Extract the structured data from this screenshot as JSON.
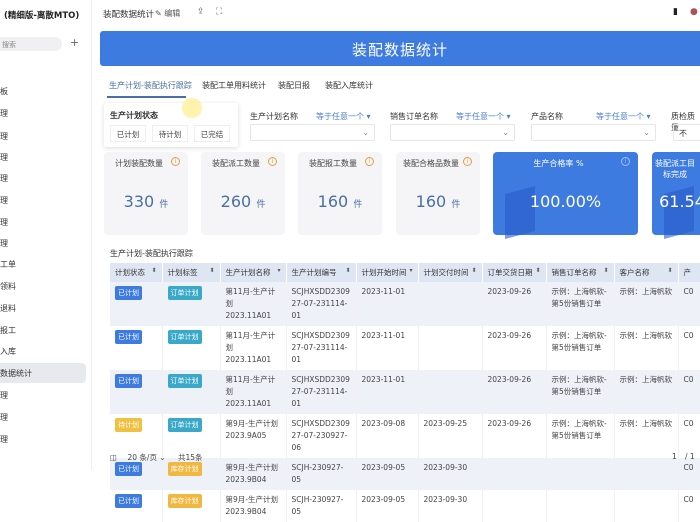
{
  "app": {
    "title": "(精细版-离散MTO)",
    "search_placeholder": "搜索",
    "add": "+"
  },
  "sidebar": {
    "items": [
      {
        "label": "板"
      },
      {
        "label": "理"
      },
      {
        "label": "理"
      },
      {
        "label": "理"
      },
      {
        "label": "理"
      },
      {
        "label": "理"
      },
      {
        "label": "理"
      },
      {
        "label": "理"
      },
      {
        "label": "工单"
      },
      {
        "label": "领料"
      },
      {
        "label": "退料"
      },
      {
        "label": "报工"
      },
      {
        "label": "入库"
      },
      {
        "label": "数据统计",
        "selected": true
      },
      {
        "label": "理"
      },
      {
        "label": "理"
      },
      {
        "label": "理"
      }
    ]
  },
  "topbar": {
    "page_name": "装配数据统计",
    "edit": "编辑",
    "icons": [
      "share-icon",
      "fullscreen-icon",
      "sidebar-toggle-icon",
      "avatar"
    ]
  },
  "banner": {
    "title": "装配数据统计"
  },
  "tabs": [
    {
      "label": "生产计划-装配执行跟踪",
      "active": true
    },
    {
      "label": "装配工单用料统计"
    },
    {
      "label": "装配日报"
    },
    {
      "label": "装配入库统计"
    }
  ],
  "status_filter": {
    "title": "生产计划状态",
    "options": [
      "已计划",
      "待计划",
      "已完结"
    ]
  },
  "filters": [
    {
      "label": "生产计划名称",
      "op": "等于任意一个"
    },
    {
      "label": "销售订单名称",
      "op": "等于任意一个"
    },
    {
      "label": "产品名称",
      "op": "等于任意一个"
    },
    {
      "label": "质检质量",
      "value": "不"
    }
  ],
  "cards": [
    {
      "title": "计划装配数量",
      "value": "330",
      "unit": "件"
    },
    {
      "title": "装配派工数量",
      "value": "260",
      "unit": "件"
    },
    {
      "title": "装配报工数量",
      "value": "160",
      "unit": "件"
    },
    {
      "title": "装配合格品数量",
      "value": "160",
      "unit": "件"
    },
    {
      "title": "生产合格率 %",
      "value": "100.00%"
    },
    {
      "title": "装配派工目标完成",
      "value": "61.54"
    }
  ],
  "table": {
    "title": "生产计划-装配执行跟踪",
    "columns": [
      "计划状态",
      "计划标签",
      "生产计划名称",
      "生产计划编号",
      "计划开始时间",
      "计划交付时间",
      "订单交货日期",
      "销售订单名称",
      "客户名称",
      "产"
    ],
    "rows": [
      {
        "status": "已计划",
        "tag": "订单计划",
        "name": "第11月-生产计划 2023.11A01",
        "code": "SCJHXSDD2309 27-07-231114-01",
        "start": "2023-11-01",
        "deliver": "",
        "order_date": "2023-09-26",
        "so": "示例：上海帆软-第5份销售订单",
        "customer": "示例：上海帆软",
        "p": "C0"
      },
      {
        "status": "已计划",
        "tag": "订单计划",
        "name": "第11月-生产计划 2023.11A01",
        "code": "SCJHXSDD2309 27-07-231114-01",
        "start": "2023-11-01",
        "deliver": "",
        "order_date": "2023-09-26",
        "so": "示例：上海帆软-第5份销售订单",
        "customer": "示例：上海帆软",
        "p": "C0"
      },
      {
        "status": "已计划",
        "tag": "订单计划",
        "name": "第11月-生产计划 2023.11A01",
        "code": "SCJHXSDD2309 27-07-231114-01",
        "start": "2023-11-01",
        "deliver": "",
        "order_date": "2023-09-26",
        "so": "示例：上海帆软-第5份销售订单",
        "customer": "示例：上海帆软",
        "p": "C0"
      },
      {
        "status": "待计划",
        "tag": "订单计划",
        "name": "第9月-生产计划 2023.9A05",
        "code": "SCJHXSDD2309 27-07-230927-06",
        "start": "2023-09-08",
        "deliver": "2023-09-25",
        "order_date": "2023-09-26",
        "so": "示例：上海帆软-第5份销售订单",
        "customer": "示例：上海帆软",
        "p": "C0"
      },
      {
        "status": "已计划",
        "tag": "库存计划",
        "name": "第9月-生产计划 2023.9B04",
        "code": "SCJH-230927-05",
        "start": "2023-09-05",
        "deliver": "2023-09-30",
        "order_date": "",
        "so": "",
        "customer": "",
        "p": "C0"
      },
      {
        "status": "已计划",
        "tag": "库存计划",
        "name": "第9月-生产计划 2023.9B04",
        "code": "SCJH-230927-05",
        "start": "2023-09-05",
        "deliver": "2023-09-30",
        "order_date": "",
        "so": "",
        "customer": "",
        "p": "C0"
      }
    ]
  },
  "pager": {
    "page_size": "20 条/页",
    "total": "共15条",
    "page": "1",
    "pages": "/ 1"
  },
  "colors": {
    "brand": "#3d7be0",
    "planned": "#3d7be0",
    "pending": "#f0c040",
    "order_tag": "#3aa8c8",
    "stock_tag": "#f0b840"
  }
}
